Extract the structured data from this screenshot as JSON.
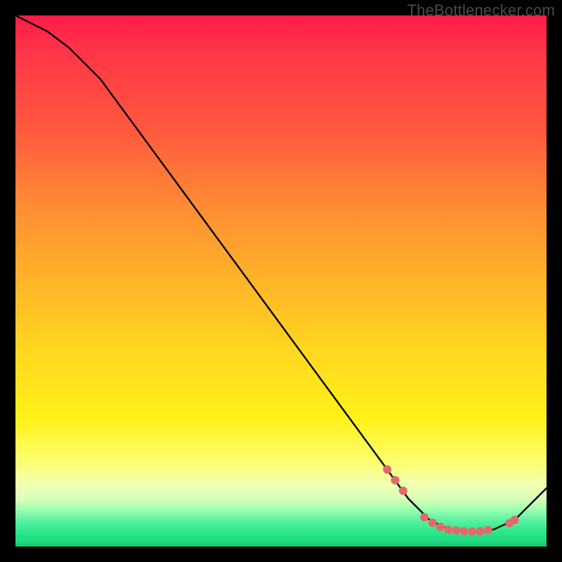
{
  "watermark": "TheBottlenecker.com",
  "chart_data": {
    "type": "line",
    "title": "",
    "xlabel": "",
    "ylabel": "",
    "xlim": [
      0,
      100
    ],
    "ylim": [
      0,
      100
    ],
    "curve_key": "curve",
    "markers_key": "markers",
    "curve": [
      {
        "x": 0,
        "y": 100
      },
      {
        "x": 6,
        "y": 97
      },
      {
        "x": 10,
        "y": 94
      },
      {
        "x": 16,
        "y": 88
      },
      {
        "x": 70,
        "y": 14.5
      },
      {
        "x": 74,
        "y": 9
      },
      {
        "x": 78,
        "y": 5
      },
      {
        "x": 82,
        "y": 3
      },
      {
        "x": 86,
        "y": 2.8
      },
      {
        "x": 90,
        "y": 3.2
      },
      {
        "x": 94,
        "y": 5
      },
      {
        "x": 100,
        "y": 11
      }
    ],
    "markers": [
      {
        "x": 70,
        "y": 14.5
      },
      {
        "x": 71.5,
        "y": 12.5
      },
      {
        "x": 73,
        "y": 10.5
      },
      {
        "x": 77,
        "y": 5.5
      },
      {
        "x": 78.5,
        "y": 4.5
      },
      {
        "x": 80,
        "y": 3.7
      },
      {
        "x": 81.5,
        "y": 3.2
      },
      {
        "x": 83,
        "y": 3.0
      },
      {
        "x": 84.5,
        "y": 2.9
      },
      {
        "x": 86,
        "y": 2.8
      },
      {
        "x": 87.5,
        "y": 2.9
      },
      {
        "x": 89,
        "y": 3.1
      },
      {
        "x": 93,
        "y": 4.4
      },
      {
        "x": 94,
        "y": 5.0
      }
    ],
    "marker_color": "#e26a6a",
    "line_color": "#000000",
    "line_width": 2.4,
    "marker_radius": 6
  }
}
